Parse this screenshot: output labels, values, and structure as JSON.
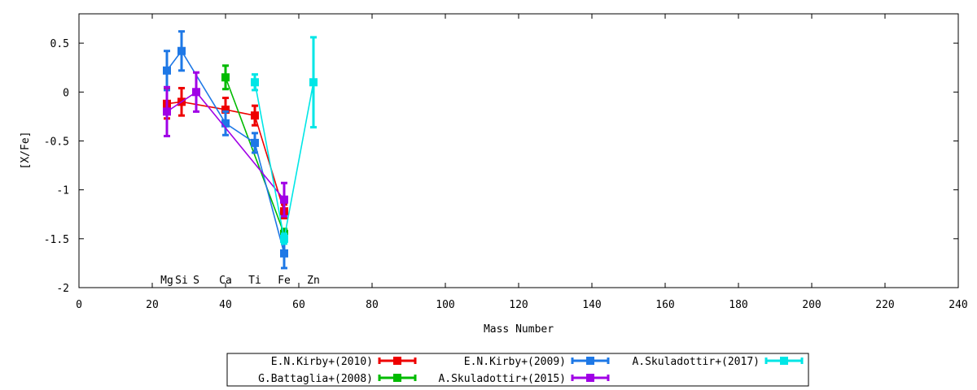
{
  "chart_data": {
    "type": "line",
    "xlabel": "Mass Number",
    "ylabel": "[X/Fe]",
    "xlim": [
      0,
      240
    ],
    "ylim": [
      -2,
      0.8
    ],
    "xticks": [
      0,
      20,
      40,
      60,
      80,
      100,
      120,
      140,
      160,
      180,
      200,
      220,
      240
    ],
    "yticks": [
      -2,
      -1.5,
      -1,
      -0.5,
      0,
      0.5
    ],
    "grid": false,
    "legend_position": "bottom-center, below plot",
    "element_labels": [
      {
        "text": "Mg",
        "x": 24
      },
      {
        "text": "Si",
        "x": 28
      },
      {
        "text": "S",
        "x": 32
      },
      {
        "text": "Ca",
        "x": 40
      },
      {
        "text": "Ti",
        "x": 48
      },
      {
        "text": "Fe",
        "x": 56
      },
      {
        "text": "Zn",
        "x": 64
      }
    ],
    "series": [
      {
        "name": "E.N.Kirby+(2010)",
        "color": "#ee0000",
        "points": [
          {
            "x": 24,
            "y": -0.12,
            "err": 0.15
          },
          {
            "x": 28,
            "y": -0.1,
            "err": 0.14
          },
          {
            "x": 40,
            "y": -0.18,
            "err": 0.12
          },
          {
            "x": 48,
            "y": -0.24,
            "err": 0.1
          },
          {
            "x": 56,
            "y": -1.22,
            "err": 0.07
          }
        ]
      },
      {
        "name": "G.Battaglia+(2008)",
        "color": "#00bb00",
        "points": [
          {
            "x": 40,
            "y": 0.15,
            "err": 0.12
          },
          {
            "x": 56,
            "y": -1.45,
            "err": 0.05
          }
        ]
      },
      {
        "name": "E.N.Kirby+(2009)",
        "color": "#1e78e6",
        "points": [
          {
            "x": 24,
            "y": 0.22,
            "err": 0.2
          },
          {
            "x": 28,
            "y": 0.42,
            "err": 0.2
          },
          {
            "x": 40,
            "y": -0.32,
            "err": 0.12
          },
          {
            "x": 48,
            "y": -0.52,
            "err": 0.1
          },
          {
            "x": 56,
            "y": -1.65,
            "err": 0.15
          }
        ]
      },
      {
        "name": "A.Skuladottir+(2015)",
        "color": "#a000e6",
        "points": [
          {
            "x": 24,
            "y": -0.2,
            "err": 0.25
          },
          {
            "x": 32,
            "y": 0.0,
            "err": 0.2
          },
          {
            "x": 56,
            "y": -1.1,
            "err": 0.17
          }
        ]
      },
      {
        "name": "A.Skuladottir+(2017)",
        "color": "#00e6e6",
        "points": [
          {
            "x": 48,
            "y": 0.1,
            "err": 0.08
          },
          {
            "x": 56,
            "y": -1.5,
            "err": 0.05
          },
          {
            "x": 64,
            "y": 0.1,
            "err": 0.46
          }
        ]
      }
    ]
  }
}
